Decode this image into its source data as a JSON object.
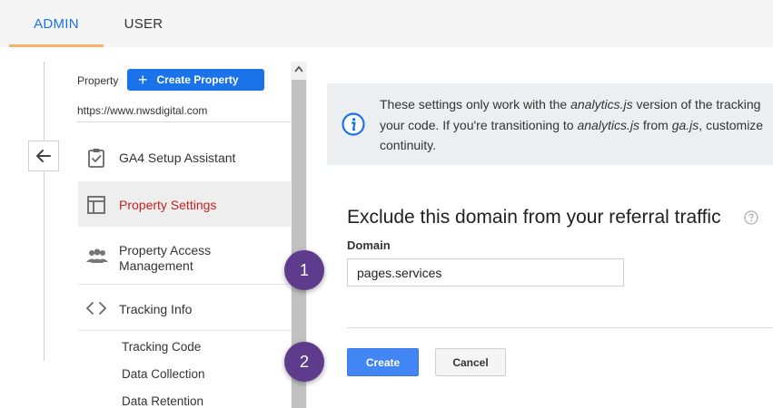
{
  "tabs": [
    {
      "label": "ADMIN",
      "active": true
    },
    {
      "label": "USER",
      "active": false
    }
  ],
  "sidebar": {
    "property_label": "Property",
    "create_property_label": "Create Property",
    "property_url": "https://www.nwsdigital.com",
    "items": [
      {
        "label": "GA4 Setup Assistant",
        "icon": "clipboard-check-icon"
      },
      {
        "label": "Property Settings",
        "icon": "window-layout-icon",
        "active": true
      },
      {
        "label": "Property Access Management",
        "label_line1": "Property Access",
        "label_line2": "Management",
        "icon": "people-icon"
      },
      {
        "label": "Tracking Info",
        "icon": "code-brackets-icon"
      }
    ],
    "sub_items": [
      "Tracking Code",
      "Data Collection",
      "Data Retention"
    ]
  },
  "info": {
    "line1_pre": "These settings only work with the ",
    "line1_em": "analytics.js",
    "line1_post": " version of the tracking",
    "line2_pre": "your code. If you're transitioning to ",
    "line2_em1": "analytics.js",
    "line2_mid": " from ",
    "line2_em2": "ga.js",
    "line2_post": ", customize",
    "line3": "continuity."
  },
  "form": {
    "title": "Exclude this domain from your referral traffic",
    "domain_label": "Domain",
    "domain_value": "pages.services",
    "create_label": "Create",
    "cancel_label": "Cancel"
  },
  "steps": [
    "1",
    "2"
  ],
  "colors": {
    "accent": "#1a73e8",
    "active_nav_text": "#c5221f",
    "tab_underline": "#f6b26b",
    "step_badge": "#5e3b8c",
    "create_button": "#4285f4",
    "info_box": "#eceff1"
  }
}
